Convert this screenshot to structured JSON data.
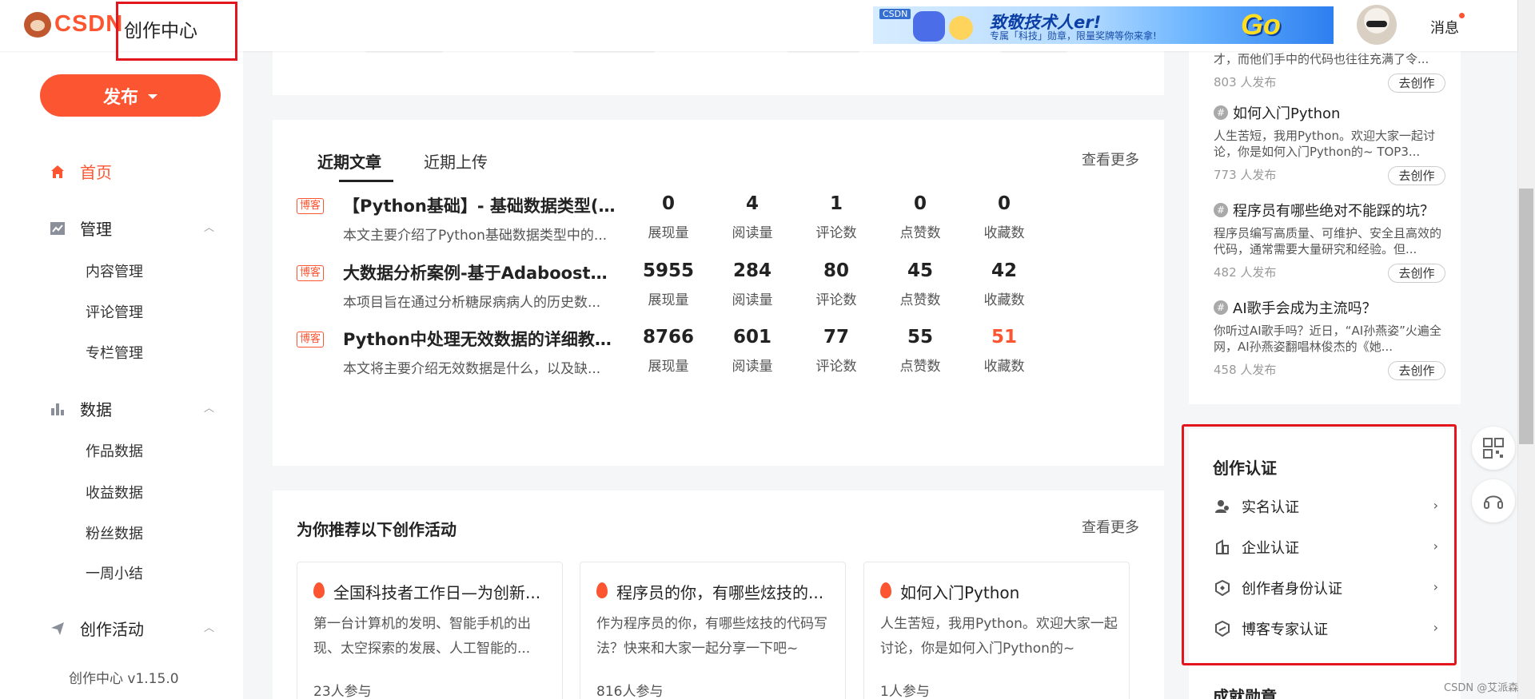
{
  "header": {
    "logo_text": "CSDN",
    "app_title": "创作中心",
    "banner": {
      "tag": "CSDN",
      "title": "致敬技术人er!",
      "subtitle": "专属「科技」勋章，限量奖牌等你来拿!",
      "go": "Go"
    },
    "messages_label": "消息"
  },
  "sidebar": {
    "publish_label": "发布",
    "nav": {
      "home": "首页",
      "manage": "管理",
      "manage_items": [
        "内容管理",
        "评论管理",
        "专栏管理"
      ],
      "data": "数据",
      "data_items": [
        "作品数据",
        "收益数据",
        "粉丝数据",
        "一周小结"
      ],
      "activities": "创作活动"
    },
    "version": "创作中心 v1.15.0"
  },
  "articles": {
    "tabs": [
      "近期文章",
      "近期上传"
    ],
    "see_more": "查看更多",
    "stat_labels": [
      "展现量",
      "阅读量",
      "评论数",
      "点赞数",
      "收藏数"
    ],
    "items": [
      {
        "badge": "博客",
        "title": "【Python基础】- 基础数据类型(上)",
        "desc": "本文主要介绍了Python基础数据类型中的...",
        "stats": [
          "0",
          "4",
          "1",
          "0",
          "0"
        ]
      },
      {
        "badge": "博客",
        "title": "大数据分析案例-基于Adaboost算...",
        "desc": "本项目旨在通过分析糖尿病病人的历史数...",
        "stats": [
          "5955",
          "284",
          "80",
          "45",
          "42"
        ]
      },
      {
        "badge": "博客",
        "title": "Python中处理无效数据的详细教程...",
        "desc": "本文将主要介绍无效数据是什么，以及缺...",
        "stats": [
          "8766",
          "601",
          "77",
          "55",
          "51"
        ]
      }
    ]
  },
  "activities": {
    "title": "为你推荐以下创作活动",
    "see_more": "查看更多",
    "cards": [
      {
        "title": "全国科技者工作日—为创新...",
        "desc": "第一台计算机的发明、智能手机的出现、太空探索的发展、人工智能的...",
        "count": "23人参与"
      },
      {
        "title": "程序员的你，有哪些炫技的...",
        "desc": "作为程序员的你，有哪些炫技的代码写法？快来和大家一起分享一下吧~",
        "count": "816人参与"
      },
      {
        "title": "如何入门Python",
        "desc": "人生苦短，我用Python。欢迎大家一起讨论，你是如何入门Python的~",
        "count": "1人参与"
      }
    ]
  },
  "topics": {
    "partial_desc": "才，而他们手中的代码也往往充满了令...",
    "partial_count": "803 人发布",
    "go_label": "去创作",
    "items": [
      {
        "title": "如何入门Python",
        "desc": "人生苦短，我用Python。欢迎大家一起讨论，你是如何入门Python的~ TOP3...",
        "count": "773 人发布"
      },
      {
        "title": "程序员有哪些绝对不能踩的坑？",
        "desc": "程序员编写高质量、可维护、安全且高效的代码，通常需要大量研究和经验。但...",
        "count": "482 人发布"
      },
      {
        "title": "AI歌手会成为主流吗？",
        "desc": "你听过AI歌手吗？近日，“AI孙燕姿”火遍全网，AI孙燕姿翻唱林俊杰的《她...",
        "count": "458 人发布"
      }
    ]
  },
  "certification": {
    "title": "创作认证",
    "items": [
      "实名认证",
      "企业认证",
      "创作者身份认证",
      "博客专家认证"
    ],
    "next_section": "成就勋章"
  },
  "watermark": "CSDN @艾派森",
  "colors": {
    "accent": "#fc5531",
    "highlight_box": "#e4161d"
  }
}
